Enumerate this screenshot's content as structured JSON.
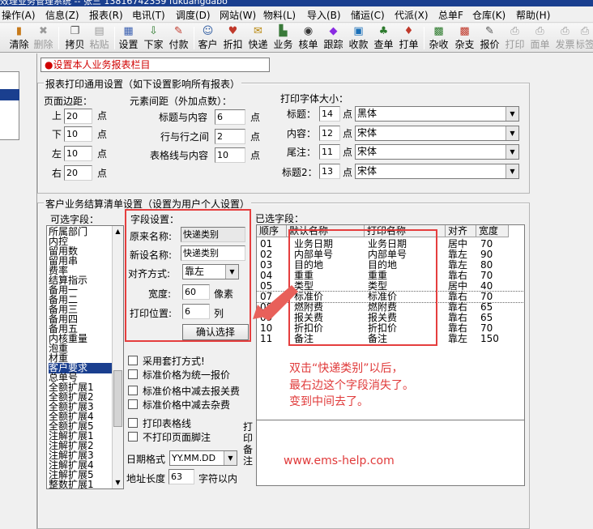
{
  "title_bar": {
    "text": "效理业务管理系统  --  张三  13816742359 fukuangdabo"
  },
  "menu": [
    {
      "label": "操作(A)"
    },
    {
      "label": "信息(Z)"
    },
    {
      "label": "报表(R)"
    },
    {
      "label": "电讯(T)"
    },
    {
      "label": "调度(D)"
    },
    {
      "label": "网站(W)"
    },
    {
      "label": "物料(L)"
    },
    {
      "label": "导入(B)"
    },
    {
      "label": "储运(C)"
    },
    {
      "label": "代派(X)"
    },
    {
      "label": "总单F"
    },
    {
      "label": "仓库(K)"
    },
    {
      "label": "帮助(H)"
    }
  ],
  "toolbar": [
    {
      "label": "清除",
      "icon": "clear-icon",
      "enabled": true
    },
    {
      "label": "删除",
      "icon": "delete-icon",
      "enabled": false
    },
    {
      "label": "拷贝",
      "icon": "copy-icon",
      "enabled": true
    },
    {
      "label": "粘贴",
      "icon": "paste-icon",
      "enabled": false
    },
    {
      "label": "设置",
      "icon": "settings-icon",
      "enabled": true
    },
    {
      "label": "下家",
      "icon": "next-party-icon",
      "enabled": true
    },
    {
      "label": "付款",
      "icon": "payment-icon",
      "enabled": true
    },
    {
      "label": "客户",
      "icon": "customers-icon",
      "enabled": true
    },
    {
      "label": "折扣",
      "icon": "discount-icon",
      "enabled": true
    },
    {
      "label": "快递",
      "icon": "express-icon",
      "enabled": true
    },
    {
      "label": "业务",
      "icon": "business-icon",
      "enabled": true
    },
    {
      "label": "核单",
      "icon": "check-order-icon",
      "enabled": true
    },
    {
      "label": "跟踪",
      "icon": "tracking-icon",
      "enabled": true
    },
    {
      "label": "收款",
      "icon": "receive-payment-icon",
      "enabled": true
    },
    {
      "label": "查单",
      "icon": "query-order-icon",
      "enabled": true
    },
    {
      "label": "打单",
      "icon": "print-order-icon",
      "enabled": true
    },
    {
      "label": "杂收",
      "icon": "misc-income-icon",
      "enabled": true
    },
    {
      "label": "杂支",
      "icon": "misc-expense-icon",
      "enabled": true
    },
    {
      "label": "报价",
      "icon": "quote-icon",
      "enabled": true
    },
    {
      "label": "打印",
      "icon": "print-icon",
      "enabled": false
    },
    {
      "label": "面单",
      "icon": "waybill-icon",
      "enabled": false
    },
    {
      "label": "发票",
      "icon": "invoice-icon",
      "enabled": false
    },
    {
      "label": "标签",
      "icon": "label-icon",
      "enabled": false
    }
  ],
  "report_title_field": {
    "value": "●设置本人业务报表栏目"
  },
  "print_settings": {
    "legend": "报表打印通用设置（如下设置影响所有报表）",
    "margins": {
      "heading": "页面边距：",
      "unit": "点",
      "items": [
        {
          "label": "上",
          "value": "20"
        },
        {
          "label": "下",
          "value": "10"
        },
        {
          "label": "左",
          "value": "10"
        },
        {
          "label": "右",
          "value": "20"
        }
      ]
    },
    "spacing": {
      "heading": "元素间距（外加点数）：",
      "unit": "点",
      "items": [
        {
          "label": "标题与内容",
          "value": "6"
        },
        {
          "label": "行与行之间",
          "value": "2"
        },
        {
          "label": "表格线与内容",
          "value": "10"
        }
      ]
    },
    "fonts": {
      "heading": "打印字体大小：",
      "unit": "点",
      "items": [
        {
          "label": "标题：",
          "size": "14",
          "font": "黑体"
        },
        {
          "label": "内容：",
          "size": "12",
          "font": "宋体"
        },
        {
          "label": "尾注：",
          "size": "11",
          "font": "宋体"
        },
        {
          "label": "标题2：",
          "size": "13",
          "font": "宋体"
        }
      ]
    }
  },
  "settlement": {
    "legend": "客户业务结算清单设置（设置为用户个人设置）",
    "available_label": "可选字段：",
    "available_fields": [
      "所属部门",
      "内控",
      "留用数",
      "留用串",
      "费率",
      "结算指示",
      "备用一",
      "备用二",
      "备用三",
      "备用四",
      "备用五",
      "内核重量",
      "泡重",
      "材重",
      "客户要求",
      "总单号",
      "全额扩展1",
      "全额扩展2",
      "全额扩展3",
      "全额扩展4",
      "全额扩展5",
      "注解扩展1",
      "注解扩展2",
      "注解扩展3",
      "注解扩展4",
      "注解扩展5",
      "整数扩展1"
    ],
    "available_selected_index": 14,
    "field_settings": {
      "heading": "字段设置：",
      "original_name_label": "原来名称:",
      "original_name_value": "快递类别",
      "new_name_label": "新设名称:",
      "new_name_value": "快递类别",
      "align_label": "对齐方式:",
      "align_value": "靠左",
      "width_label": "宽度:",
      "width_value": "60",
      "width_unit": "像素",
      "position_label": "打印位置:",
      "position_value": "6",
      "position_unit": "列",
      "confirm_button": "确认选择"
    },
    "options": [
      {
        "label": "采用套打方式!",
        "checked": false
      },
      {
        "label": "标准价格为统一报价",
        "checked": false
      },
      {
        "label": "标准价格中减去报关费",
        "checked": false
      },
      {
        "label": "标准价格中减去杂费",
        "checked": false
      },
      {
        "label": "打印表格线",
        "checked": false
      },
      {
        "label": "不打印页面脚注",
        "checked": false
      }
    ],
    "date_format_label": "日期格式",
    "date_format_value": "YY.MM.DD",
    "address_length_label": "地址长度",
    "address_length_value": "63",
    "address_length_unit": "字符以内",
    "selected_label": "已选字段：",
    "selected_headers": [
      "顺序",
      "默认名称",
      "打印名称",
      "对齐",
      "宽度"
    ],
    "selected_rows": [
      {
        "order": "01",
        "default": "业务日期",
        "print": "业务日期",
        "align": "居中",
        "width": "70"
      },
      {
        "order": "02",
        "default": "内部单号",
        "print": "内部单号",
        "align": "靠左",
        "width": "90"
      },
      {
        "order": "03",
        "default": "目的地",
        "print": "目的地",
        "align": "靠左",
        "width": "80"
      },
      {
        "order": "04",
        "default": "重重",
        "print": "重重",
        "align": "靠右",
        "width": "70"
      },
      {
        "order": "05",
        "default": "类型",
        "print": "类型",
        "align": "居中",
        "width": "40"
      },
      {
        "order": "07",
        "default": "标准价",
        "print": "标准价",
        "align": "靠右",
        "width": "70"
      },
      {
        "order": "08",
        "default": "燃附费",
        "print": "燃附费",
        "align": "靠右",
        "width": "65"
      },
      {
        "order": "09",
        "default": "报关费",
        "print": "报关费",
        "align": "靠右",
        "width": "65"
      },
      {
        "order": "10",
        "default": "折扣价",
        "print": "折扣价",
        "align": "靠右",
        "width": "70"
      },
      {
        "order": "11",
        "default": "备注",
        "print": "备注",
        "align": "靠左",
        "width": "150"
      }
    ],
    "notes_label": "打印备注"
  },
  "annotation": {
    "lines": [
      "双击“快递类别”以后，",
      "最右边这个字段消失了。",
      "变到中间去了。"
    ],
    "url": "www.ems-help.com",
    "color": "#e03a3a"
  }
}
